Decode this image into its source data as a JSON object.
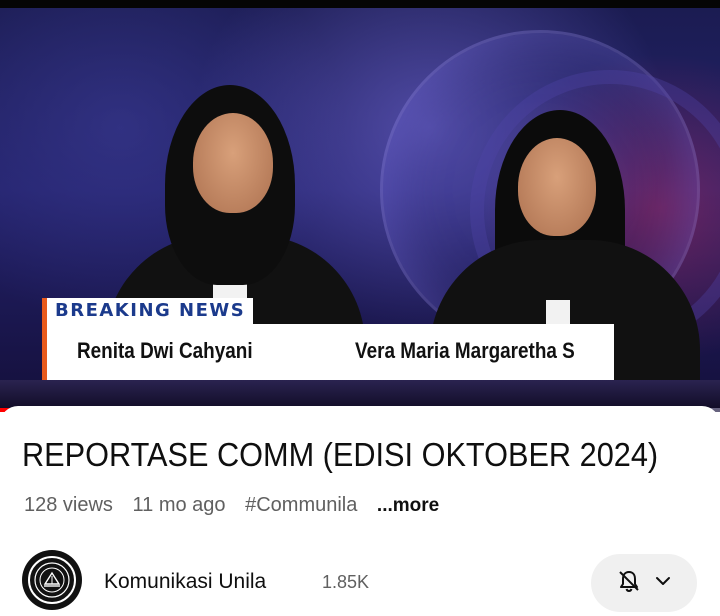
{
  "video": {
    "breaking_label": "BREAKING NEWS",
    "presenter_left": "Renita Dwi Cahyani",
    "presenter_right": "Vera Maria Margaretha S",
    "progress_played_fraction": 0.04,
    "progress_buffered_fraction": 0.16
  },
  "info": {
    "title": "REPORTASE COMM (EDISI OKTOBER 2024)",
    "views": "128 views",
    "age": "11 mo ago",
    "hashtag": "#Communila",
    "more_label": "...more"
  },
  "channel": {
    "name": "Komunikasi Unila",
    "subscribers": "1.85K",
    "avatar_icon": "university-seal-icon",
    "notification_icon": "bell-off-icon",
    "dropdown_icon": "chevron-down-icon"
  },
  "colors": {
    "progress_played": "#ff0000",
    "lower_third_accent": "#e85a1c",
    "breaking_text": "#1b3a8c"
  }
}
